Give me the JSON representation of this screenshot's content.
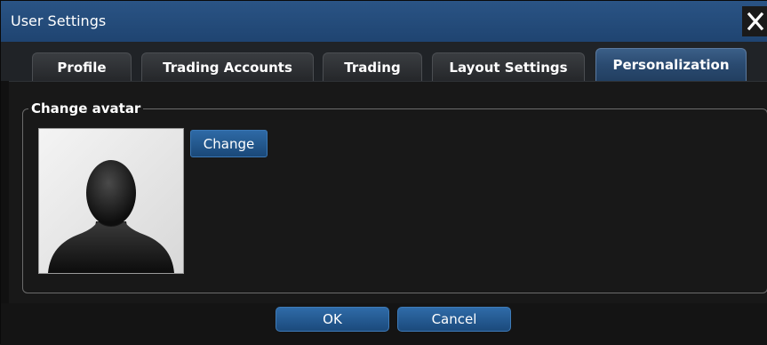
{
  "window": {
    "title": "User Settings",
    "close_icon": "close-icon"
  },
  "tabs": [
    {
      "label": "Profile",
      "active": false
    },
    {
      "label": "Trading Accounts",
      "active": false
    },
    {
      "label": "Trading",
      "active": false
    },
    {
      "label": "Layout Settings",
      "active": false
    },
    {
      "label": "Personalization",
      "active": true
    }
  ],
  "avatar_section": {
    "legend": "Change avatar",
    "avatar_icon": "user-silhouette-icon",
    "change_label": "Change"
  },
  "footer": {
    "ok_label": "OK",
    "cancel_label": "Cancel"
  },
  "colors": {
    "title_bar": "#1f4471",
    "accent_button": "#2f6ba8",
    "active_tab": "#2a4a70",
    "background": "#181818"
  }
}
